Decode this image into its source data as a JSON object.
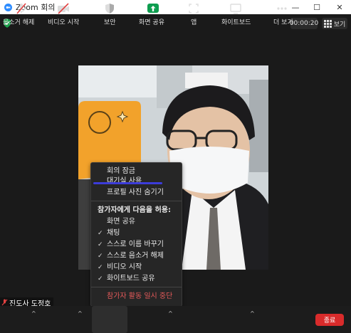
{
  "window": {
    "title": "Zoom 회의",
    "minimize": "—",
    "maximize": "☐",
    "close": "✕"
  },
  "header": {
    "timer": "00:00:20",
    "view_label": "보기"
  },
  "participant": {
    "name": "진도사 도정호"
  },
  "menu": {
    "items_top": [
      "회의 잠금",
      "대기실 사용",
      "프로필 사진 숨기기"
    ],
    "allow_header": "참가자에게 다음을 허용:",
    "allow_items": [
      {
        "label": "화면 공유",
        "checked": false
      },
      {
        "label": "채팅",
        "checked": true
      },
      {
        "label": "스스로 이름 바꾸기",
        "checked": true
      },
      {
        "label": "스스로 음소거 해제",
        "checked": true
      },
      {
        "label": "비디오 시작",
        "checked": true
      },
      {
        "label": "화이트보드 공유",
        "checked": true
      }
    ],
    "danger_item": "참가자 활동 일시 중단"
  },
  "toolbar": {
    "unmute": "음소거 해제",
    "start_video": "비디오 시작",
    "security": "보안",
    "share_screen": "화면 공유",
    "apps": "앱",
    "whiteboard": "화이트보드",
    "more": "더 보기",
    "end": "종료"
  },
  "colors": {
    "accent_blue": "#2d8cff",
    "share_green": "#0e9d4f",
    "end_red": "#d92b2b",
    "danger_text": "#e55a5a",
    "annotation_underline": "#3c3cd9"
  }
}
